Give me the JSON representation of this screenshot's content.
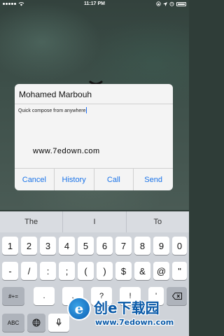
{
  "status_bar": {
    "time": "11:17 PM",
    "icons": [
      "signal-dots-icon",
      "wifi-icon",
      "lock-rotation-icon",
      "location-icon",
      "alarm-icon",
      "battery-icon"
    ]
  },
  "compose": {
    "recipient": "Mohamed Marbouh",
    "body": "Quick compose from anywhere",
    "watermark": "www.7edown.com",
    "actions": [
      "Cancel",
      "History",
      "Call",
      "Send"
    ]
  },
  "keyboard": {
    "suggestions": [
      "The",
      "I",
      "To"
    ],
    "row1": [
      "1",
      "2",
      "3",
      "4",
      "5",
      "6",
      "7",
      "8",
      "9",
      "0"
    ],
    "row2": [
      "-",
      "/",
      ":",
      ";",
      "(",
      ")",
      "$",
      "&",
      "@",
      "\""
    ],
    "row3_left": "#+=",
    "row3": [
      ".",
      ",",
      "?",
      "!",
      "'"
    ],
    "row4": [
      "ABC"
    ]
  },
  "logo": {
    "mark": "e",
    "brand": "创e下载园",
    "url": "www.7edown.com"
  },
  "colors": {
    "accent": "#1a73e8",
    "caret": "#1e6ff5",
    "keyboard_bg": "#cfd3d9"
  }
}
